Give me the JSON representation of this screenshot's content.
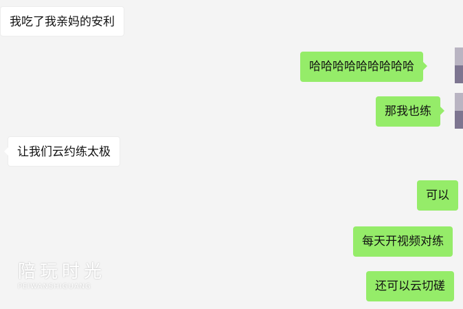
{
  "chat": {
    "messages": [
      {
        "text": "我吃了我亲妈的安利",
        "side": "in"
      },
      {
        "text": "哈哈哈哈哈哈哈哈哈",
        "side": "out"
      },
      {
        "text": "那我也练",
        "side": "out"
      },
      {
        "text": "让我们云约练太极",
        "side": "in"
      },
      {
        "text": "可以",
        "side": "out"
      },
      {
        "text": "每天开视频对练",
        "side": "out"
      },
      {
        "text": "还可以云切磋",
        "side": "out"
      }
    ]
  },
  "watermark": {
    "title": "陪玩时光",
    "subtitle": "PEIWANSHIGUANG"
  },
  "colors": {
    "background": "#f4f4f4",
    "outgoing_bubble": "#95ec69",
    "incoming_bubble": "#ffffff",
    "text": "#111111"
  }
}
